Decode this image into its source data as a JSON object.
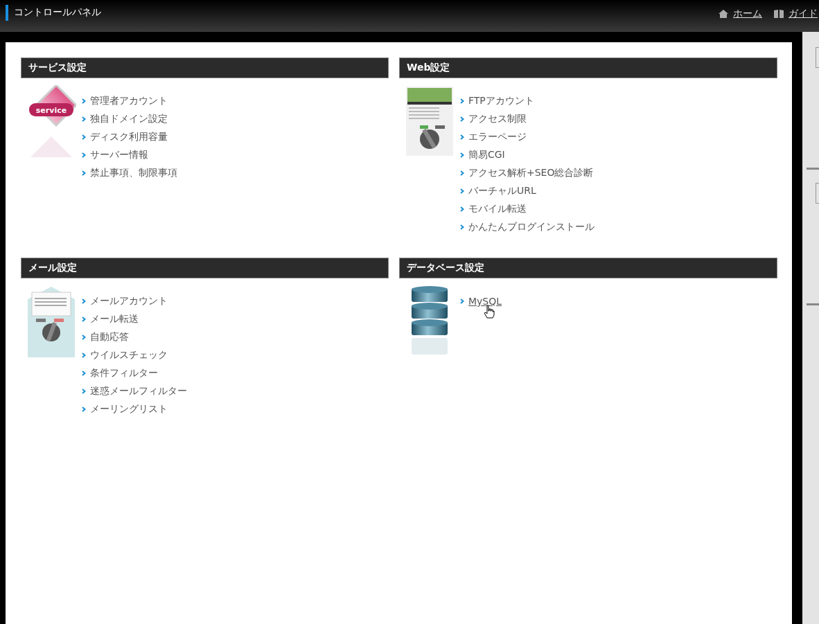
{
  "header": {
    "title": "コントロールパネル",
    "links": [
      {
        "label": "ホーム",
        "kind": "home"
      },
      {
        "label": "ガイド",
        "kind": "guide"
      }
    ]
  },
  "sections": [
    {
      "title": "サービス設定",
      "kind": "service",
      "icon_label": "service",
      "links": [
        {
          "label": "管理者アカウント",
          "hovered": false
        },
        {
          "label": "独自ドメイン設定",
          "hovered": false
        },
        {
          "label": "ディスク利用容量",
          "hovered": false
        },
        {
          "label": "サーバー情報",
          "hovered": false
        },
        {
          "label": "禁止事項、制限事項",
          "hovered": false
        }
      ]
    },
    {
      "title": "Web設定",
      "kind": "web",
      "links": [
        {
          "label": "FTPアカウント",
          "hovered": false
        },
        {
          "label": "アクセス制限",
          "hovered": false
        },
        {
          "label": "エラーページ",
          "hovered": false
        },
        {
          "label": "簡易CGI",
          "hovered": false
        },
        {
          "label": "アクセス解析+SEO総合診断",
          "hovered": false
        },
        {
          "label": "バーチャルURL",
          "hovered": false
        },
        {
          "label": "モバイル転送",
          "hovered": false
        },
        {
          "label": "かんたんブログインストール",
          "hovered": false
        }
      ]
    },
    {
      "title": "メール設定",
      "kind": "mail",
      "links": [
        {
          "label": "メールアカウント",
          "hovered": false
        },
        {
          "label": "メール転送",
          "hovered": false
        },
        {
          "label": "自動応答",
          "hovered": false
        },
        {
          "label": "ウイルスチェック",
          "hovered": false
        },
        {
          "label": "条件フィルター",
          "hovered": false
        },
        {
          "label": "迷惑メールフィルター",
          "hovered": false
        },
        {
          "label": "メーリングリスト",
          "hovered": false
        }
      ]
    },
    {
      "title": "データベース設定",
      "kind": "database",
      "links": [
        {
          "label": "MySQL",
          "hovered": true
        }
      ]
    }
  ]
}
